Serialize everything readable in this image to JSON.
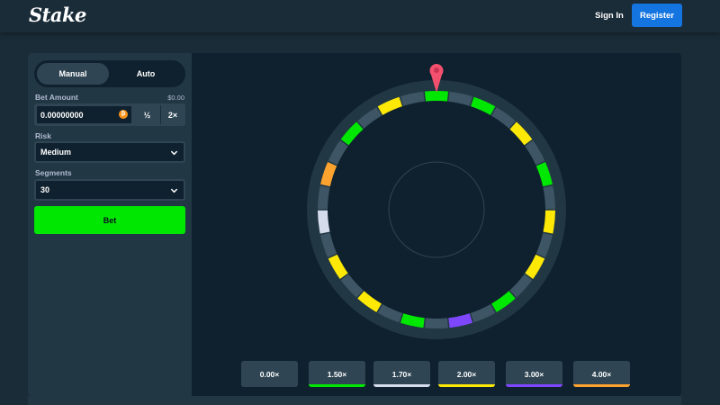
{
  "header": {
    "logo": "Stake",
    "signin_label": "Sign In",
    "register_label": "Register"
  },
  "sidebar": {
    "tabs": [
      {
        "label": "Manual",
        "active": true
      },
      {
        "label": "Auto",
        "active": false
      }
    ],
    "bet_amount": {
      "label": "Bet Amount",
      "usd_value": "$0.00",
      "value": "0.00000000",
      "coin_icon": "bitcoin-icon",
      "half_label": "½",
      "double_label": "2×"
    },
    "risk": {
      "label": "Risk",
      "value": "Medium"
    },
    "segments": {
      "label": "Segments",
      "value": "30"
    },
    "bet_button_label": "Bet"
  },
  "wheel": {
    "segment_count": 30,
    "pointer_icon": "pointer-pin-icon",
    "segments": [
      "green",
      "gray",
      "green",
      "gray",
      "yellow",
      "gray",
      "green",
      "gray",
      "yellow",
      "gray",
      "yellow",
      "gray",
      "green",
      "gray",
      "purple",
      "gray",
      "green",
      "gray",
      "yellow",
      "gray",
      "yellow",
      "gray",
      "white",
      "gray",
      "orange",
      "gray",
      "green",
      "gray",
      "yellow",
      "gray"
    ]
  },
  "multipliers": [
    {
      "label": "0.00×",
      "color": "#2f4553"
    },
    {
      "label": "1.50×",
      "color": "#00e701"
    },
    {
      "label": "1.70×",
      "color": "#d5dceb"
    },
    {
      "label": "2.00×",
      "color": "#fde905"
    },
    {
      "label": "3.00×",
      "color": "#7f47fd"
    },
    {
      "label": "4.00×",
      "color": "#fca32f"
    }
  ],
  "colors": {
    "green": "#00e701",
    "gray": "#2f4553",
    "yellow": "#fde905",
    "white": "#d5dceb",
    "purple": "#7f47fd",
    "orange": "#fca32f",
    "pointer": "#f2506e",
    "accent": "#1475e1"
  }
}
